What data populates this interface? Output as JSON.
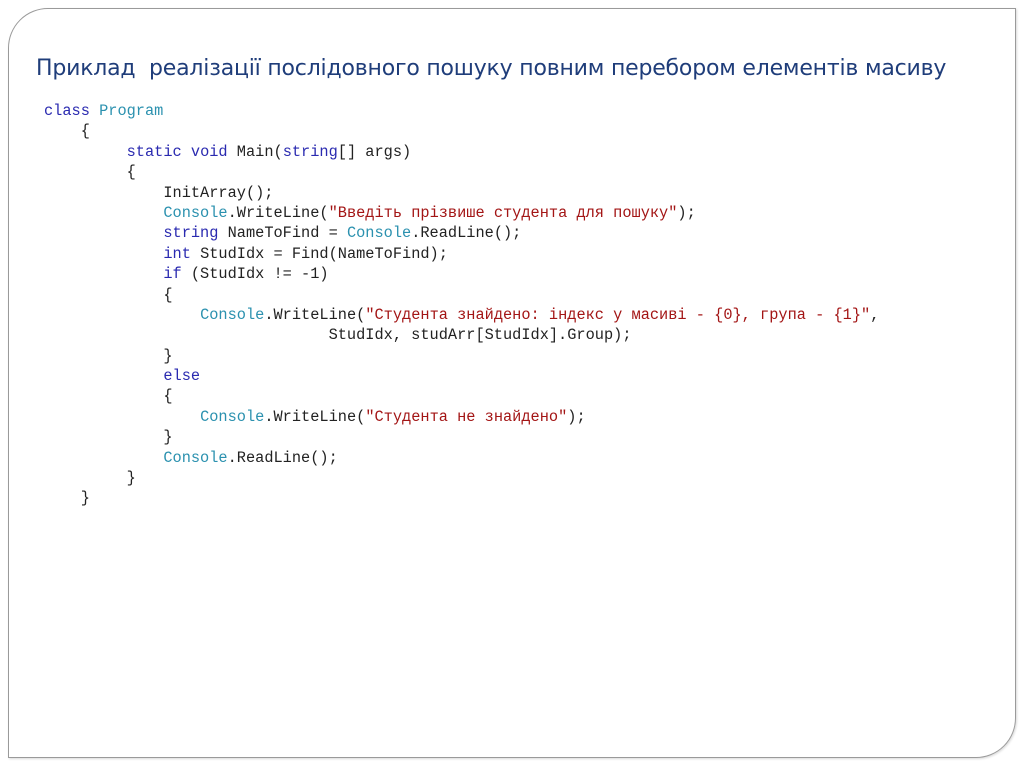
{
  "slide": {
    "title": "Приклад  реалізації послідовного пошуку повним перебором елементів масиву"
  },
  "colors": {
    "title": "#1f3d7a",
    "keyword": "#2a2ab0",
    "type": "#2b91af",
    "string": "#a31515",
    "text": "#222222",
    "frame_border": "#9a9a9a"
  },
  "code": {
    "language": "csharp",
    "lines": [
      [
        {
          "t": "kw",
          "v": "class"
        },
        {
          "t": "plain",
          "v": " "
        },
        {
          "t": "type",
          "v": "Program"
        }
      ],
      [
        {
          "t": "plain",
          "v": "    {"
        }
      ],
      [
        {
          "t": "plain",
          "v": "         "
        },
        {
          "t": "kw",
          "v": "static"
        },
        {
          "t": "plain",
          "v": " "
        },
        {
          "t": "kw",
          "v": "void"
        },
        {
          "t": "plain",
          "v": " Main("
        },
        {
          "t": "kw",
          "v": "string"
        },
        {
          "t": "plain",
          "v": "[] args)"
        }
      ],
      [
        {
          "t": "plain",
          "v": "         {"
        }
      ],
      [
        {
          "t": "plain",
          "v": "             InitArray();"
        }
      ],
      [
        {
          "t": "plain",
          "v": "             "
        },
        {
          "t": "type",
          "v": "Console"
        },
        {
          "t": "plain",
          "v": ".WriteLine("
        },
        {
          "t": "str",
          "v": "\"Введіть прізвише студента для пошуку\""
        },
        {
          "t": "plain",
          "v": ");"
        }
      ],
      [
        {
          "t": "plain",
          "v": "             "
        },
        {
          "t": "kw",
          "v": "string"
        },
        {
          "t": "plain",
          "v": " NameToFind = "
        },
        {
          "t": "type",
          "v": "Console"
        },
        {
          "t": "plain",
          "v": ".ReadLine();"
        }
      ],
      [
        {
          "t": "plain",
          "v": "             "
        },
        {
          "t": "kw",
          "v": "int"
        },
        {
          "t": "plain",
          "v": " StudIdx = Find(NameToFind);"
        }
      ],
      [
        {
          "t": "plain",
          "v": "             "
        },
        {
          "t": "kw",
          "v": "if"
        },
        {
          "t": "plain",
          "v": " (StudIdx != -1)"
        }
      ],
      [
        {
          "t": "plain",
          "v": "             {"
        }
      ],
      [
        {
          "t": "plain",
          "v": "                 "
        },
        {
          "t": "type",
          "v": "Console"
        },
        {
          "t": "plain",
          "v": ".WriteLine("
        },
        {
          "t": "str",
          "v": "\"Студента знайдено: індекс у масиві - {0}, група - {1}\""
        },
        {
          "t": "plain",
          "v": ","
        }
      ],
      [
        {
          "t": "plain",
          "v": "                               StudIdx, studArr[StudIdx].Group);"
        }
      ],
      [
        {
          "t": "plain",
          "v": "             }"
        }
      ],
      [
        {
          "t": "plain",
          "v": "             "
        },
        {
          "t": "kw",
          "v": "else"
        }
      ],
      [
        {
          "t": "plain",
          "v": "             {"
        }
      ],
      [
        {
          "t": "plain",
          "v": "                 "
        },
        {
          "t": "type",
          "v": "Console"
        },
        {
          "t": "plain",
          "v": ".WriteLine("
        },
        {
          "t": "str",
          "v": "\"Студента не знайдено\""
        },
        {
          "t": "plain",
          "v": ");"
        }
      ],
      [
        {
          "t": "plain",
          "v": "             }"
        }
      ],
      [
        {
          "t": "plain",
          "v": "             "
        },
        {
          "t": "type",
          "v": "Console"
        },
        {
          "t": "plain",
          "v": ".ReadLine();"
        }
      ],
      [
        {
          "t": "plain",
          "v": "         }"
        }
      ],
      [
        {
          "t": "plain",
          "v": "    }"
        }
      ]
    ]
  }
}
